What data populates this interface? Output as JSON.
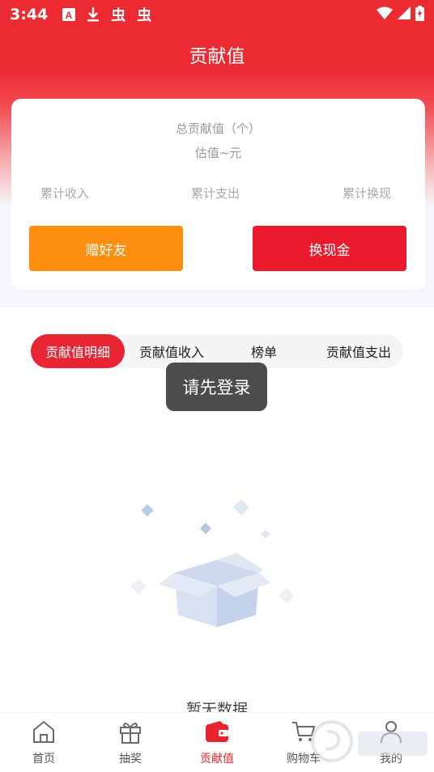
{
  "status_bar": {
    "time": "3:44",
    "left_icons": [
      "font-app-icon",
      "download-icon",
      "bug-icon",
      "bug-icon"
    ],
    "bug_glyph": "虫",
    "right_icons": [
      "wifi-icon",
      "signal-icon",
      "battery-charging-icon"
    ]
  },
  "header": {
    "title": "贡献值"
  },
  "summary": {
    "total_label": "总贡献值（个）",
    "estimate_label": "估值~元",
    "stats": {
      "income": "累计收入",
      "expense": "累计支出",
      "exchange": "累计换现"
    },
    "gift_button": "赠好友",
    "cash_button": "换现金"
  },
  "tabs": {
    "items": [
      "贡献值明细",
      "贡献值收入",
      "榜单",
      "贡献值支出"
    ],
    "active_index": 0
  },
  "toast": "请先登录",
  "empty_state": {
    "text": "暂无数据"
  },
  "bottom_nav": {
    "items": [
      {
        "label": "首页",
        "icon": "home-icon"
      },
      {
        "label": "抽奖",
        "icon": "gift-icon"
      },
      {
        "label": "贡献值",
        "icon": "wallet-icon"
      },
      {
        "label": "购物车",
        "icon": "cart-icon"
      },
      {
        "label": "我的",
        "icon": "user-icon"
      }
    ],
    "active_index": 2
  },
  "colors": {
    "brand_red": "#ec2a31",
    "orange": "#fd8e0f",
    "tab_active": "#ea2533",
    "toast_bg": "#4c4c4c"
  }
}
